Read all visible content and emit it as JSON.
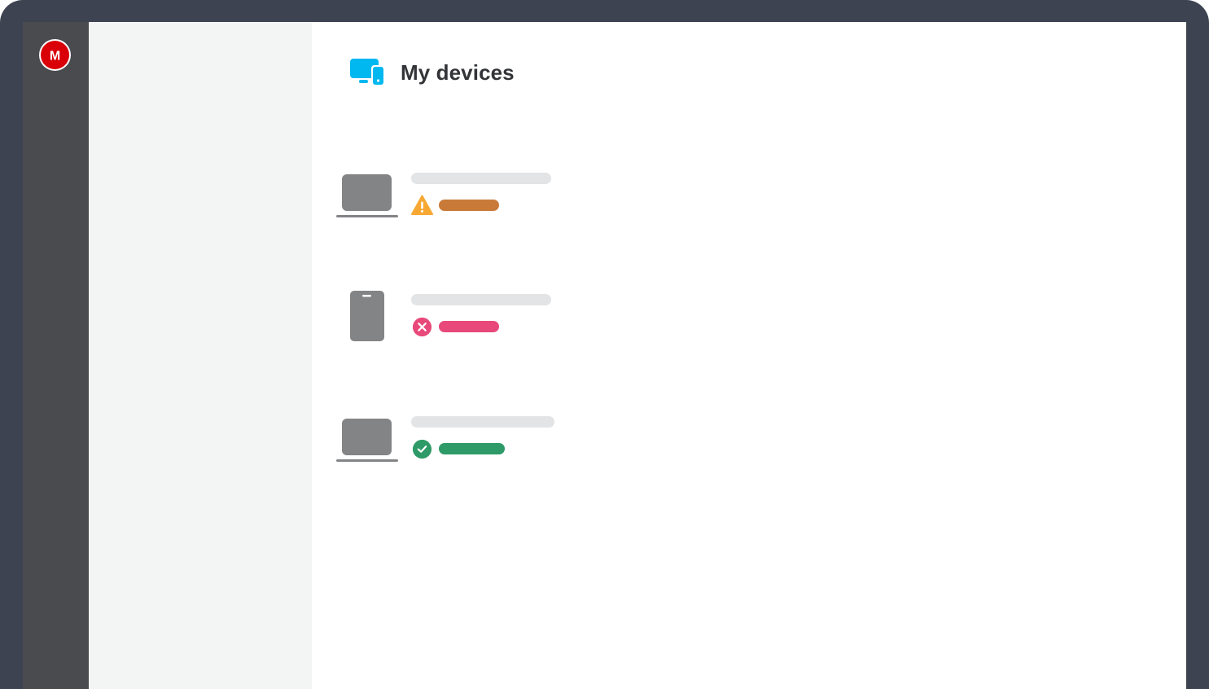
{
  "app": {
    "logo_letter": "M",
    "brand_color": "#d90007"
  },
  "header": {
    "title": "My devices",
    "icon": "devices-icon",
    "icon_color": "#00b8f0"
  },
  "devices": [
    {
      "type": "laptop",
      "icon": "laptop-icon",
      "name": "",
      "status": "warning",
      "status_icon": "warning-icon",
      "status_text": "",
      "status_color": "#c97a39",
      "status_icon_color": "#f7a833"
    },
    {
      "type": "phone",
      "icon": "phone-icon",
      "name": "",
      "status": "error",
      "status_icon": "error-icon",
      "status_text": "",
      "status_color": "#e8497a",
      "status_icon_color": "#e8497a"
    },
    {
      "type": "laptop",
      "icon": "laptop-icon",
      "name": "",
      "status": "ok",
      "status_icon": "check-icon",
      "status_text": "",
      "status_color": "#2e9a67",
      "status_icon_color": "#2e9a67"
    }
  ]
}
